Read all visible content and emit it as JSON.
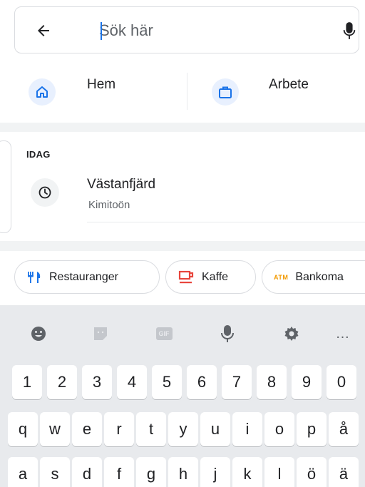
{
  "search": {
    "placeholder": "Sök här",
    "value": ""
  },
  "shortcuts": [
    {
      "label": "Hem",
      "icon": "home-icon"
    },
    {
      "label": "Arbete",
      "icon": "briefcase-icon"
    }
  ],
  "recent": {
    "section_label": "IDAG",
    "items": [
      {
        "title": "Västanfjärd",
        "subtitle": "Kimitoön",
        "icon": "history-icon"
      }
    ]
  },
  "chips": [
    {
      "label": "Restauranger",
      "icon": "restaurant-icon",
      "color": "#1a73e8"
    },
    {
      "label": "Kaffe",
      "icon": "coffee-icon",
      "color": "#e8453c"
    },
    {
      "label": "Bankoma",
      "icon": "atm-icon",
      "icon_text": "ATM",
      "color": "#f29900"
    }
  ],
  "keyboard": {
    "toolbar": [
      "emoji-icon",
      "sticker-icon",
      "gif-icon",
      "microphone-icon",
      "settings-icon",
      "more-icon"
    ],
    "gif_label": "GIF",
    "more_label": "…",
    "row_numbers": [
      "1",
      "2",
      "3",
      "4",
      "5",
      "6",
      "7",
      "8",
      "9",
      "0"
    ],
    "row_top": [
      "q",
      "w",
      "e",
      "r",
      "t",
      "y",
      "u",
      "i",
      "o",
      "p",
      "å"
    ],
    "row_middle": [
      "a",
      "s",
      "d",
      "f",
      "g",
      "h",
      "j",
      "k",
      "l",
      "ö",
      "ä"
    ]
  },
  "colors": {
    "accent": "#1a73e8",
    "icon_bg": "#e8f0fe",
    "keyboard_bg": "#e8eaed",
    "icon_grey": "#5f6368"
  }
}
